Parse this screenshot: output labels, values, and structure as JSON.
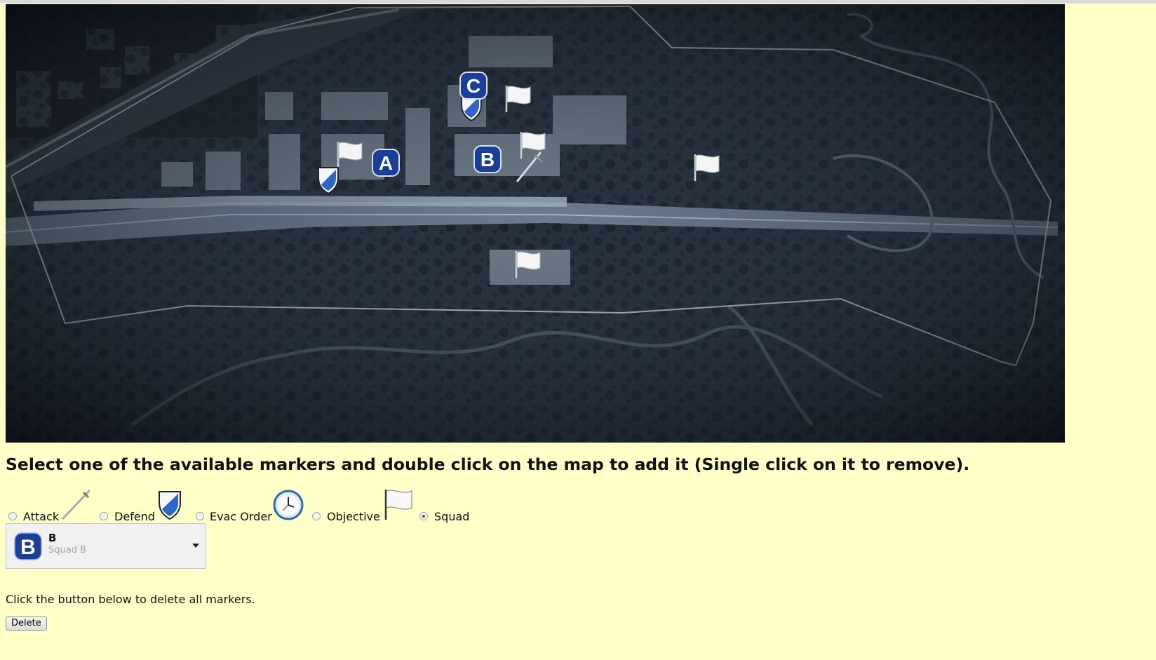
{
  "instructions": "Select one of the available markers and double click on the map to add it (Single click on it to remove).",
  "marker_options": [
    {
      "label": "Attack",
      "icon": "sword-icon",
      "checked": false
    },
    {
      "label": "Defend",
      "icon": "shield-icon",
      "checked": false
    },
    {
      "label": "Evac Order",
      "icon": "clock-icon",
      "checked": false
    },
    {
      "label": "Objective",
      "icon": "flag-icon",
      "checked": false
    },
    {
      "label": "Squad",
      "icon": "",
      "checked": true
    }
  ],
  "squad_select": {
    "badge_letter": "B",
    "title": "B",
    "subtitle": "Squad B"
  },
  "map": {
    "objective_labels": [
      "A",
      "B",
      "C"
    ],
    "colors": {
      "badge": "#1a3f9a",
      "background": "#ffffc8"
    }
  },
  "delete_text": "Click the button below to delete all markers.",
  "delete_button": "Delete"
}
